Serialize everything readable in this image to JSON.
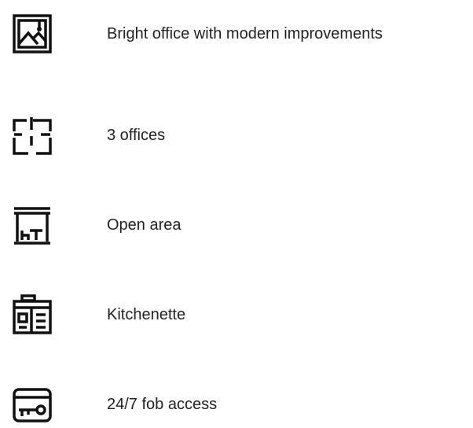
{
  "features": [
    {
      "icon": "landscape-picture-icon",
      "label": "Bright office with modern improvements"
    },
    {
      "icon": "floor-plan-icon",
      "label": "3 offices"
    },
    {
      "icon": "open-area-icon",
      "label": "Open area"
    },
    {
      "icon": "kitchen-cabinet-icon",
      "label": "Kitchenette"
    },
    {
      "icon": "key-fob-icon",
      "label": "24/7 fob access"
    }
  ],
  "colors": {
    "icon": "#111111",
    "text": "#222222",
    "background": "#ffffff"
  }
}
